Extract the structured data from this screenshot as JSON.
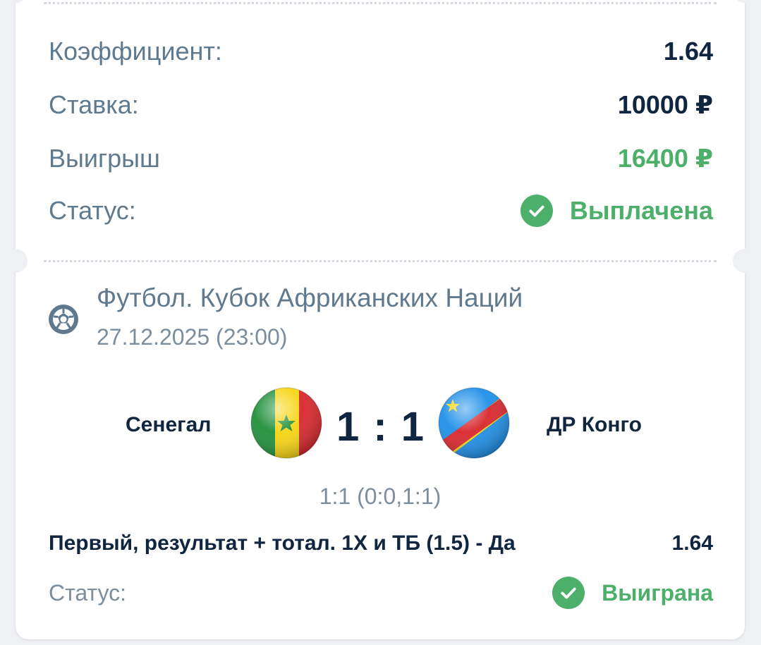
{
  "summary": {
    "coef_label": "Коэффициент:",
    "coef_value": "1.64",
    "stake_label": "Ставка:",
    "stake_value": "10000 ₽",
    "win_label": "Выигрыш",
    "win_value": "16400 ₽",
    "status_label": "Статус:",
    "status_value": "Выплачена",
    "status_icon": "check-circle-icon"
  },
  "event": {
    "sport_icon": "soccer-ball-icon",
    "title": "Футбол. Кубок Африканских Наций",
    "datetime": "27.12.2025 (23:00)",
    "home_team": "Сенегал",
    "away_team": "ДР Конго",
    "home_flag": "senegal-flag-icon",
    "away_flag": "dr-congo-flag-icon",
    "score": "1 : 1",
    "score_detail": "1:1 (0:0,1:1)"
  },
  "bet": {
    "market": "Первый, результат + тотал. 1Х и ТБ (1.5) - Да",
    "odds": "1.64",
    "status_label": "Статус:",
    "status_value": "Выиграна",
    "status_icon": "check-circle-icon"
  },
  "colors": {
    "accent_green": "#4caf6a",
    "label_gray_blue": "#5f7a8f",
    "dark_text": "#10253f"
  }
}
